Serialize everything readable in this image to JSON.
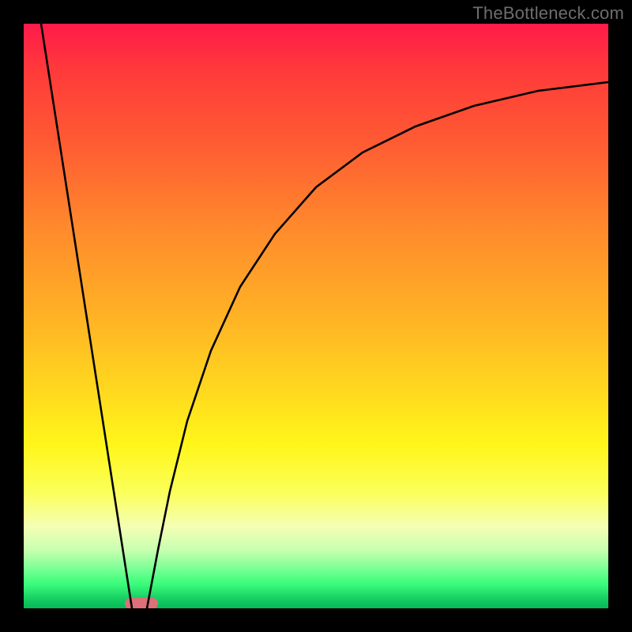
{
  "watermark": "TheBottleneck.com",
  "chart_data": {
    "type": "line",
    "title": "",
    "xlabel": "",
    "ylabel": "",
    "xlim": [
      0,
      100
    ],
    "ylim": [
      0,
      100
    ],
    "grid": false,
    "legend": "none",
    "background_gradient": {
      "direction": "vertical",
      "stops": [
        {
          "pos": 0.0,
          "color": "#ff1a4a"
        },
        {
          "pos": 0.08,
          "color": "#ff3a3a"
        },
        {
          "pos": 0.2,
          "color": "#ff5a33"
        },
        {
          "pos": 0.35,
          "color": "#ff8a2c"
        },
        {
          "pos": 0.5,
          "color": "#ffb225"
        },
        {
          "pos": 0.62,
          "color": "#ffd61f"
        },
        {
          "pos": 0.72,
          "color": "#fff61a"
        },
        {
          "pos": 0.8,
          "color": "#fbff58"
        },
        {
          "pos": 0.86,
          "color": "#f4ffb4"
        },
        {
          "pos": 0.9,
          "color": "#c8ffb0"
        },
        {
          "pos": 0.93,
          "color": "#80ff98"
        },
        {
          "pos": 0.95,
          "color": "#4cff82"
        },
        {
          "pos": 0.97,
          "color": "#2be770"
        },
        {
          "pos": 0.99,
          "color": "#0fc55e"
        },
        {
          "pos": 1.0,
          "color": "#08b956"
        }
      ]
    },
    "series": [
      {
        "name": "left-line",
        "type": "line",
        "color": "#000000",
        "x": [
          3,
          18.5
        ],
        "y": [
          100,
          0
        ]
      },
      {
        "name": "right-curve",
        "type": "line",
        "color": "#000000",
        "x": [
          21,
          23,
          25,
          28,
          32,
          37,
          43,
          50,
          58,
          67,
          77,
          88,
          100
        ],
        "y": [
          0,
          10,
          20,
          32,
          44,
          55,
          64,
          72,
          78,
          82.5,
          86,
          88.5,
          90
        ]
      }
    ],
    "markers": [
      {
        "name": "bottom-highlight",
        "shape": "rounded-rect",
        "color": "#e07078",
        "x_center": 20,
        "y_center": 0,
        "width": 5.6,
        "height": 2.2
      }
    ],
    "notes": "Axes unlabeled; values are visual estimates in a 0–100 normalized coordinate space. The two black curves form a V/well shape with a minimum near x≈20, y≈0; the right curve rises asymptotically toward y≈90 at x=100."
  }
}
